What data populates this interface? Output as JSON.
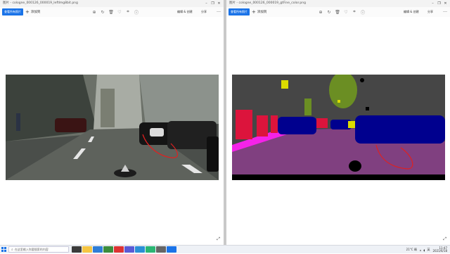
{
  "left": {
    "title": "图片 - cologne_000126_000019_leftImg8bit.png",
    "image_name": "cologne_000126_000019_leftImg8bit.png",
    "image_type": "photo"
  },
  "right": {
    "title": "图片 - cologne_000126_000019_gtFine_color.png",
    "image_name": "cologne_000126_000019_gtFine_color.png",
    "image_type": "segmentation-mask"
  },
  "toolbar": {
    "primary_label": "查看所有照片",
    "add_label": "添加到",
    "edit_label": "编辑 & 创建",
    "share_label": "分享",
    "tool_icons": [
      "zoom-in-icon",
      "rotate-icon",
      "delete-icon",
      "favorite-icon",
      "crop-icon",
      "info-icon"
    ]
  },
  "window_controls": [
    "minimize-icon",
    "restore-icon",
    "close-icon"
  ],
  "taskbar": {
    "search_placeholder": "在这里输入你要搜索的内容",
    "weather": "21°C 晴",
    "time": "11:47",
    "date": "2021/6/18",
    "lang": "英"
  },
  "colors": {
    "accent": "#1a73e8",
    "seg_sky": "#464646",
    "seg_road": "#804080",
    "seg_car": "#00008e",
    "seg_person": "#dc143c",
    "seg_vegetation": "#6b8e23",
    "seg_sidewalk": "#f423e8",
    "seg_sign": "#dcdc00",
    "annotation": "#e02020"
  }
}
